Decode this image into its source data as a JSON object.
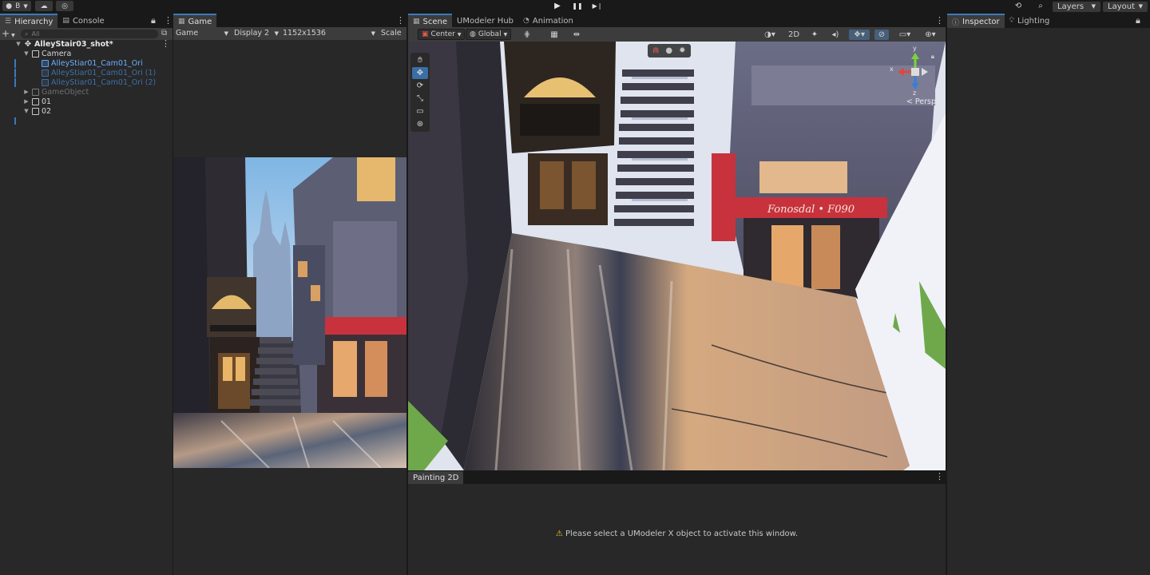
{
  "toolbar": {
    "account_label": "B",
    "account_icon": "account-icon",
    "cloud_icon": "cloud-icon",
    "collab_icon": "collab-icon",
    "play_icon": "▶",
    "pause_icon": "❚❚",
    "step_icon": "▶❘",
    "history_icon": "history-icon",
    "search_icon": "search-icon",
    "layers_label": "Layers",
    "layout_label": "Layout"
  },
  "hierarchy": {
    "tabs": [
      {
        "label": "Hierarchy",
        "active": true
      },
      {
        "label": "Console",
        "active": false
      }
    ],
    "search_placeholder": "All",
    "scene_name": "AlleyStair03_shot*",
    "items": [
      {
        "label": "Camera",
        "level": 1,
        "expanded": true,
        "style": "normal"
      },
      {
        "label": "AlleyStiar01_Cam01_Ori",
        "level": 2,
        "style": "prefab"
      },
      {
        "label": "AlleyStiar01_Cam01_Ori (1)",
        "level": 2,
        "style": "prefab-dim"
      },
      {
        "label": "AlleyStiar01_Cam01_Ori (2)",
        "level": 2,
        "style": "prefab-dim"
      },
      {
        "label": "GameObject",
        "level": 1,
        "expanded": false,
        "style": "disabled"
      },
      {
        "label": "01",
        "level": 1,
        "expanded": false,
        "style": "normal"
      },
      {
        "label": "02",
        "level": 1,
        "expanded": true,
        "style": "normal"
      }
    ]
  },
  "game": {
    "tab_label": "Game",
    "mode": "Game",
    "display": "Display 2",
    "resolution": "1152x1536",
    "scale_label": "Scale"
  },
  "scene": {
    "tabs": [
      {
        "label": "Scene",
        "active": true
      },
      {
        "label": "UModeler Hub",
        "active": false
      },
      {
        "label": "Animation",
        "active": false
      }
    ],
    "pivot_mode": "Center",
    "pivot_rotation": "Global",
    "mode_2d_label": "2D",
    "persp_label": "< Persp",
    "gizmo_axes": {
      "x": "x",
      "y": "y",
      "z": "z"
    },
    "tools": [
      "hand-tool",
      "move-tool",
      "rotate-tool",
      "scale-tool",
      "rect-tool",
      "transform-tool"
    ],
    "shop_sign_text": "Fonosdal • F090"
  },
  "painting": {
    "tab_label": "Painting 2D",
    "message": "Please select a UModeler X object to activate this window."
  },
  "inspector": {
    "tabs": [
      {
        "label": "Inspector",
        "active": true
      },
      {
        "label": "Lighting",
        "active": false
      }
    ]
  },
  "colors": {
    "accent": "#3a79bb",
    "prefab_blue": "#57a4ff",
    "panel_bg": "#282828",
    "toolbar_bg": "#3c3c3c",
    "sign_red": "#c8323c",
    "warning": "#f2c230"
  }
}
